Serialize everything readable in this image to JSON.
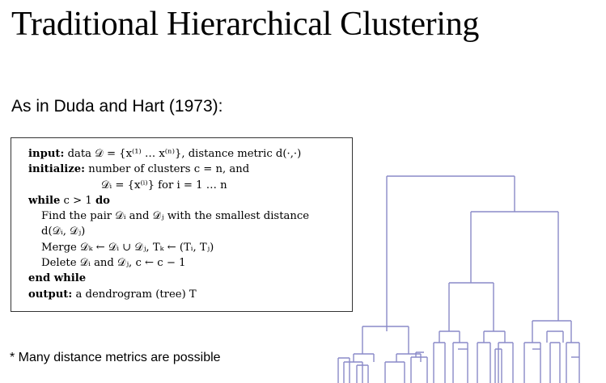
{
  "slide": {
    "title": "Traditional Hierarchical Clustering",
    "subtitle": "As in Duda and Hart (1973):",
    "footnote": "* Many distance metrics are possible"
  },
  "algorithm": {
    "lines": [
      {
        "keyword": "input:",
        "text": " data 𝒟 = {x⁽¹⁾ … x⁽ⁿ⁾}, distance metric d(·,·)"
      },
      {
        "keyword": "initialize:",
        "text": " number of clusters c = n, and"
      },
      {
        "keyword": "",
        "text": "𝒟ᵢ = {x⁽ⁱ⁾} for i = 1 … n"
      },
      {
        "keyword": "while",
        "text": " c > 1 ",
        "keyword2": "do"
      },
      {
        "keyword": "",
        "text": "Find the pair 𝒟ᵢ and 𝒟ⱼ with the smallest distance"
      },
      {
        "keyword": "",
        "text": "d(𝒟ᵢ, 𝒟ⱼ)"
      },
      {
        "keyword": "",
        "text": "Merge 𝒟ₖ ← 𝒟ᵢ ∪ 𝒟ⱼ,   Tₖ ← (Tᵢ, Tⱼ)"
      },
      {
        "keyword": "",
        "text": "Delete 𝒟ᵢ and 𝒟ⱼ, c ← c − 1"
      },
      {
        "keyword": "end while",
        "text": ""
      },
      {
        "keyword": "output:",
        "text": " a dendrogram (tree) T"
      }
    ]
  },
  "dendrogram": {
    "color": "#8a8ac8"
  }
}
